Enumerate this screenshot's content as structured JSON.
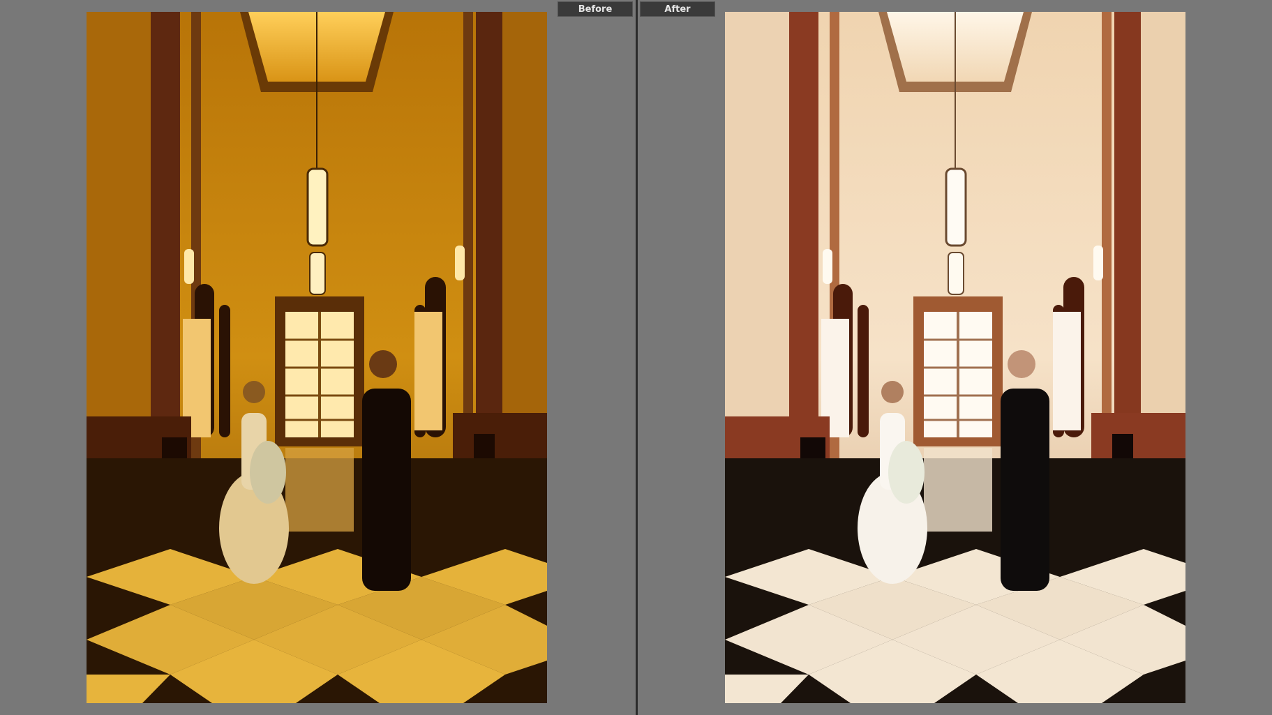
{
  "compare_view": {
    "before_label": "Before",
    "after_label": "After"
  },
  "colors": {
    "workspace_bg": "#787878",
    "divider": "#2b2b2b",
    "label_bg": "#3a3a3a",
    "label_text": "#e6e6e6"
  },
  "photos": {
    "before_tone": {
      "wall": "#c8890f",
      "wall_dark": "#7a4a06",
      "light_tile": "#e7b43c",
      "dark_tile": "#150a02",
      "pillar": "#6a2b12"
    },
    "after_tone": {
      "wall": "#f3dcc0",
      "wall_dark": "#c29a76",
      "light_tile": "#f3e6d2",
      "dark_tile": "#0f0c0a",
      "pillar": "#8a3a22"
    }
  }
}
